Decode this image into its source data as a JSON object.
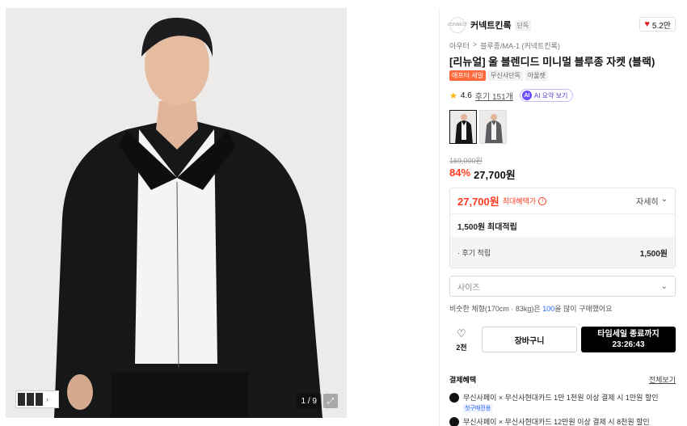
{
  "gallery": {
    "counter": "1 / 9",
    "expand_icon": "expand-icon",
    "thumbs_icon": "chevron-right-icon"
  },
  "brand": {
    "logo_text": "CONNECT",
    "name": "커넥트킨록",
    "tag": "단독",
    "likes": "5.2만"
  },
  "breadcrumb": [
    "아우터",
    ">",
    "블루종/MA-1 (커넥트킨록)"
  ],
  "product": {
    "title": "[리뉴얼] 울 블렌디드 미니멀 블루종 자켓 (블랙)",
    "tags": [
      "애프터 세일",
      "무신사단독",
      "아울렛"
    ],
    "rating": "4.6",
    "review_label": "후기 151개",
    "ai_label": "AI 요약 보기",
    "ai_badge": "AI"
  },
  "pricing": {
    "original": "169,000원",
    "discount": "84%",
    "price": "27,700원",
    "max_benefit_price": "27,700원",
    "max_benefit_label": "최대혜택가",
    "detail_label": "자세히",
    "points_total": "1,500원 최대적립",
    "review_points_label": "· 후기 적립",
    "review_points_value": "1,500원"
  },
  "options": {
    "size_placeholder": "사이즈",
    "similar_prefix": "비슷한 체형(170cm · 83kg)은 ",
    "similar_highlight": "100",
    "similar_suffix": "을 많이 구매했어요"
  },
  "actions": {
    "like_count": "2천",
    "cart_label": "장바구니",
    "buy_line1": "타임세일 종료까지",
    "buy_line2": "23:26:43"
  },
  "payment": {
    "title": "결제혜택",
    "view_all": "전체보기",
    "items": [
      {
        "text": "무신사페이 × 무신사현대카드 1만 1천원 이상 결제 시 1만원 할인",
        "badge": "첫구매전용"
      },
      {
        "text": "무신사페이 × 무신사현대카드 12만원 이상 결제 시 8천원 할인",
        "badge": ""
      }
    ]
  },
  "colors": {
    "accent_red": "#ff3b1f",
    "buy_button": "#000000",
    "ai_purple": "#6a4cff",
    "star": "#f7b500"
  }
}
